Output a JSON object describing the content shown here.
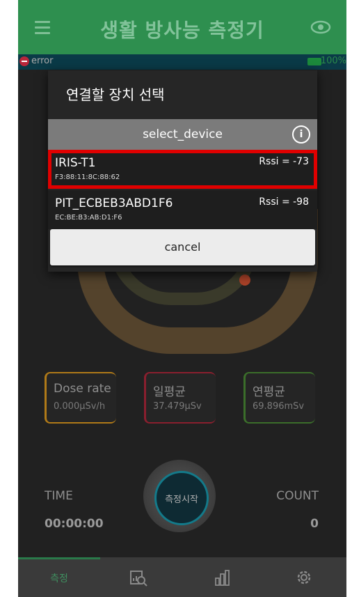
{
  "app": {
    "title": "생활 방사능 측정기",
    "status": "error",
    "battery": "100%"
  },
  "cards": [
    {
      "title": "Dose rate",
      "value": "0.000μSv/h",
      "color": "#b07a18"
    },
    {
      "title": "일평균",
      "value": "37.479μSv",
      "color": "#8a1f2e"
    },
    {
      "title": "연평균",
      "value": "69.896mSv",
      "color": "#3b6e2a"
    }
  ],
  "measure": {
    "time_label": "TIME",
    "time_value": "00:00:00",
    "count_label": "COUNT",
    "count_value": "0",
    "start_label": "측정시작"
  },
  "nav": {
    "items": [
      {
        "label": "측정",
        "icon": "measure-tab"
      },
      {
        "label": "",
        "icon": "search-chart-icon"
      },
      {
        "label": "",
        "icon": "bar-chart-icon"
      },
      {
        "label": "",
        "icon": "gear-icon"
      }
    ]
  },
  "dialog": {
    "title": "연결할 장치 선택",
    "subheader": "select_device",
    "devices": [
      {
        "name": "IRIS-T1",
        "mac": "F3:88:11:8C:88:62",
        "rssi": "Rssi = -73",
        "selected": true
      },
      {
        "name": "PIT_ECBEB3ABD1F6",
        "mac": "EC:BE:B3:AB:D1:F6",
        "rssi": "Rssi = -98",
        "selected": false
      }
    ],
    "cancel_label": "cancel"
  }
}
